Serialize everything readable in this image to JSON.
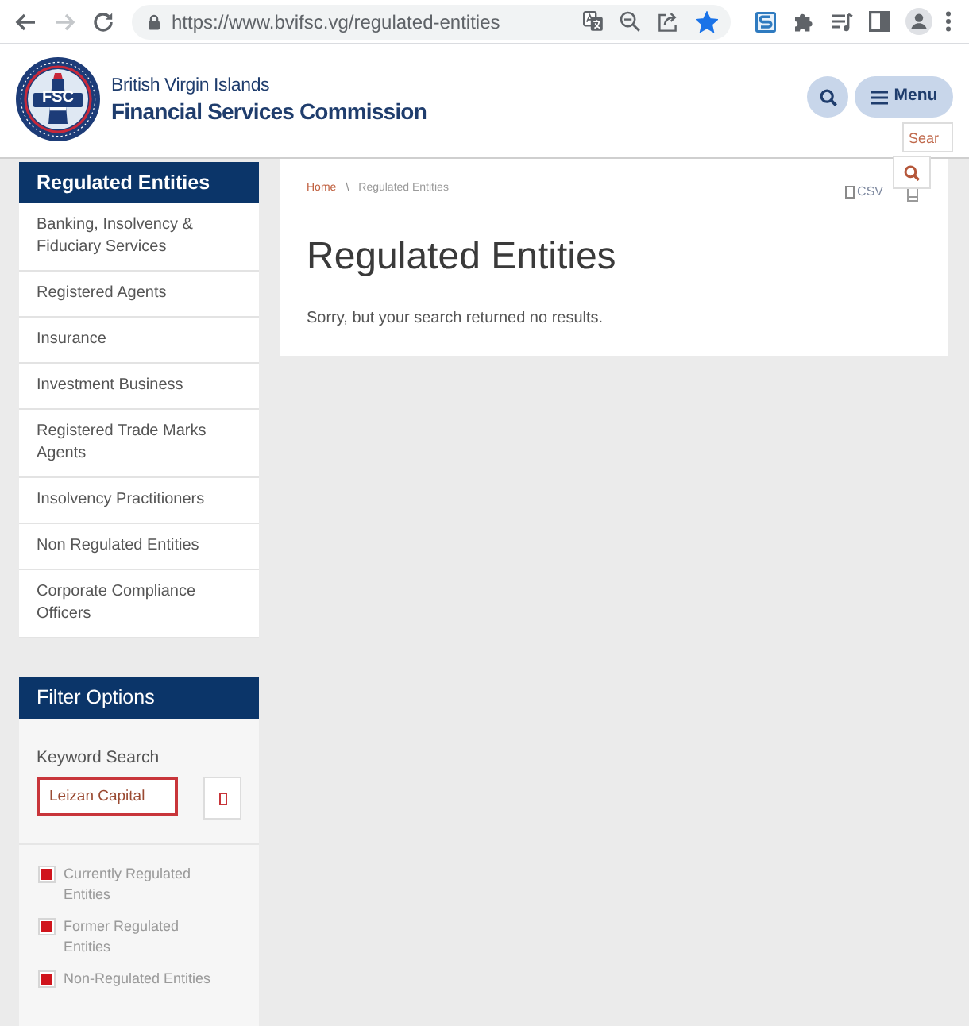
{
  "browser": {
    "back_enabled": true,
    "forward_enabled": false,
    "url": "https://www.bvifsc.vg/regulated-entities",
    "bookmarked": true
  },
  "header": {
    "logo_text": "FSC",
    "org_name_line_1": "British Virgin Islands",
    "org_name_line_2": "Financial Services Commission",
    "menu_label": "Menu",
    "search_placeholder": "Sear"
  },
  "sidebar": {
    "title": "Regulated Entities",
    "items": [
      {
        "label": "Banking, Insolvency & Fiduciary Services",
        "selected": false
      },
      {
        "label": "Registered Agents",
        "selected": false
      },
      {
        "label": "Insurance",
        "selected": false
      },
      {
        "label": "Investment Business",
        "selected": false
      },
      {
        "label": "Registered Trade Marks Agents",
        "selected": false
      },
      {
        "label": "Insolvency Practitioners",
        "selected": false
      },
      {
        "label": "Non Regulated Entities",
        "selected": false
      },
      {
        "label": "Corporate Compliance Officers",
        "selected": false
      }
    ]
  },
  "filter": {
    "title": "Filter Options",
    "keyword_label": "Keyword Search",
    "keyword_value": "Leizan Capital",
    "statuses": [
      {
        "label": "Currently Regulated Entities",
        "checked": true
      },
      {
        "label": "Former Regulated Entities",
        "checked": true
      },
      {
        "label": "Non-Regulated Entities",
        "checked": true
      }
    ]
  },
  "content": {
    "breadcrumb": [
      "Home",
      "Regulated Entities"
    ],
    "breadcrumb_separator": "\\",
    "export_label": "CSV",
    "title": "Regulated Entities",
    "message": "Sorry, but your search returned no results."
  }
}
